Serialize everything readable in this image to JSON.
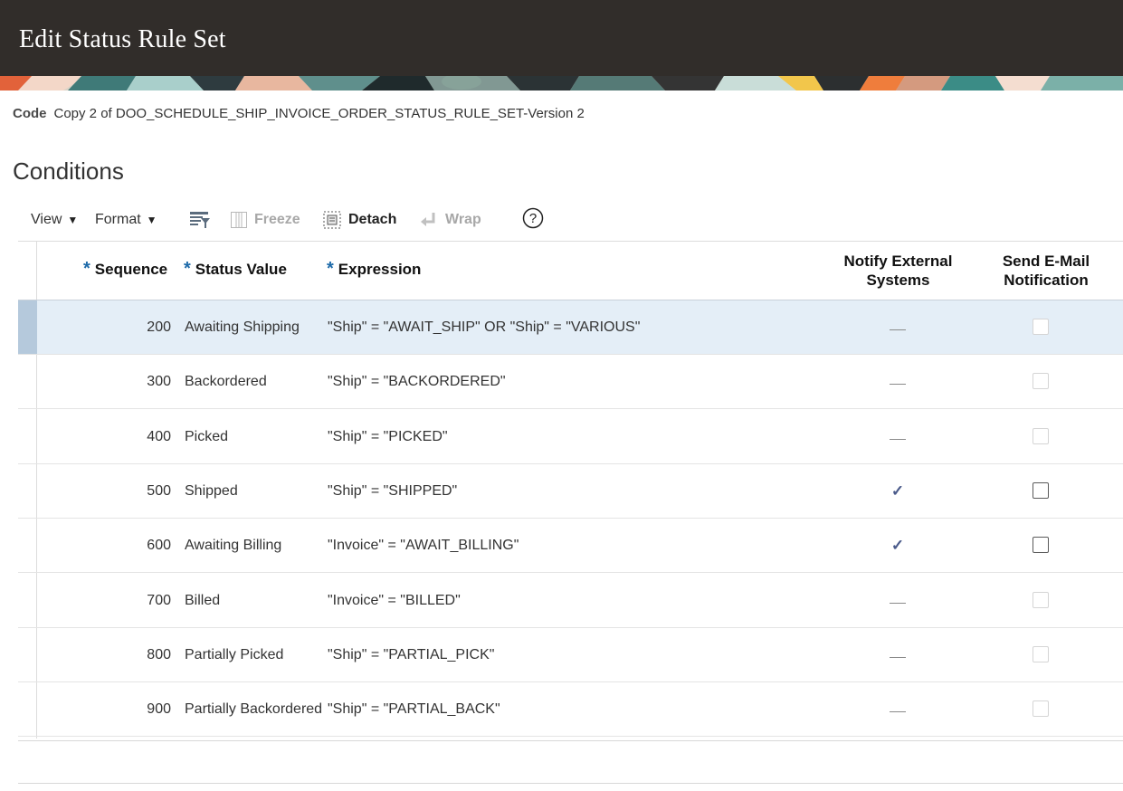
{
  "page": {
    "title": "Edit Status Rule Set"
  },
  "code": {
    "label": "Code",
    "value": "Copy 2 of DOO_SCHEDULE_SHIP_INVOICE_ORDER_STATUS_RULE_SET-Version 2"
  },
  "section": {
    "title": "Conditions"
  },
  "toolbar": {
    "view_label": "View",
    "format_label": "Format",
    "freeze_label": "Freeze",
    "detach_label": "Detach",
    "wrap_label": "Wrap",
    "help_icon": "help-icon",
    "filter_icon": "query-by-example-icon"
  },
  "columns": {
    "sequence": "Sequence",
    "status_value": "Status Value",
    "expression": "Expression",
    "notify_line1": "Notify External",
    "notify_line2": "Systems",
    "email_line1": "Send E-Mail",
    "email_line2": "Notification",
    "required_marker": "*"
  },
  "rows": [
    {
      "sequence": "200",
      "status": "Awaiting Shipping",
      "expression": "\"Ship\" = \"AWAIT_SHIP\" OR \"Ship\" = \"VARIOUS\"",
      "notify": false,
      "email_enabled": false,
      "selected": true
    },
    {
      "sequence": "300",
      "status": "Backordered",
      "expression": "\"Ship\" = \"BACKORDERED\"",
      "notify": false,
      "email_enabled": false,
      "selected": false
    },
    {
      "sequence": "400",
      "status": "Picked",
      "expression": "\"Ship\" = \"PICKED\"",
      "notify": false,
      "email_enabled": false,
      "selected": false
    },
    {
      "sequence": "500",
      "status": "Shipped",
      "expression": "\"Ship\" = \"SHIPPED\"",
      "notify": true,
      "email_enabled": true,
      "selected": false
    },
    {
      "sequence": "600",
      "status": "Awaiting Billing",
      "expression": "\"Invoice\" = \"AWAIT_BILLING\"",
      "notify": true,
      "email_enabled": true,
      "selected": false
    },
    {
      "sequence": "700",
      "status": "Billed",
      "expression": "\"Invoice\" = \"BILLED\"",
      "notify": false,
      "email_enabled": false,
      "selected": false
    },
    {
      "sequence": "800",
      "status": "Partially Picked",
      "expression": "\"Ship\" = \"PARTIAL_PICK\"",
      "notify": false,
      "email_enabled": false,
      "selected": false
    },
    {
      "sequence": "900",
      "status": "Partially Backordered",
      "expression": "\"Ship\" = \"PARTIAL_BACK\"",
      "notify": false,
      "email_enabled": false,
      "selected": false
    }
  ],
  "symbols": {
    "check": "✓"
  },
  "colors": {
    "header_bg": "#312d2a",
    "selected_row": "#e4eef7",
    "required": "#1d6aa9",
    "check": "#4a5a8a"
  }
}
